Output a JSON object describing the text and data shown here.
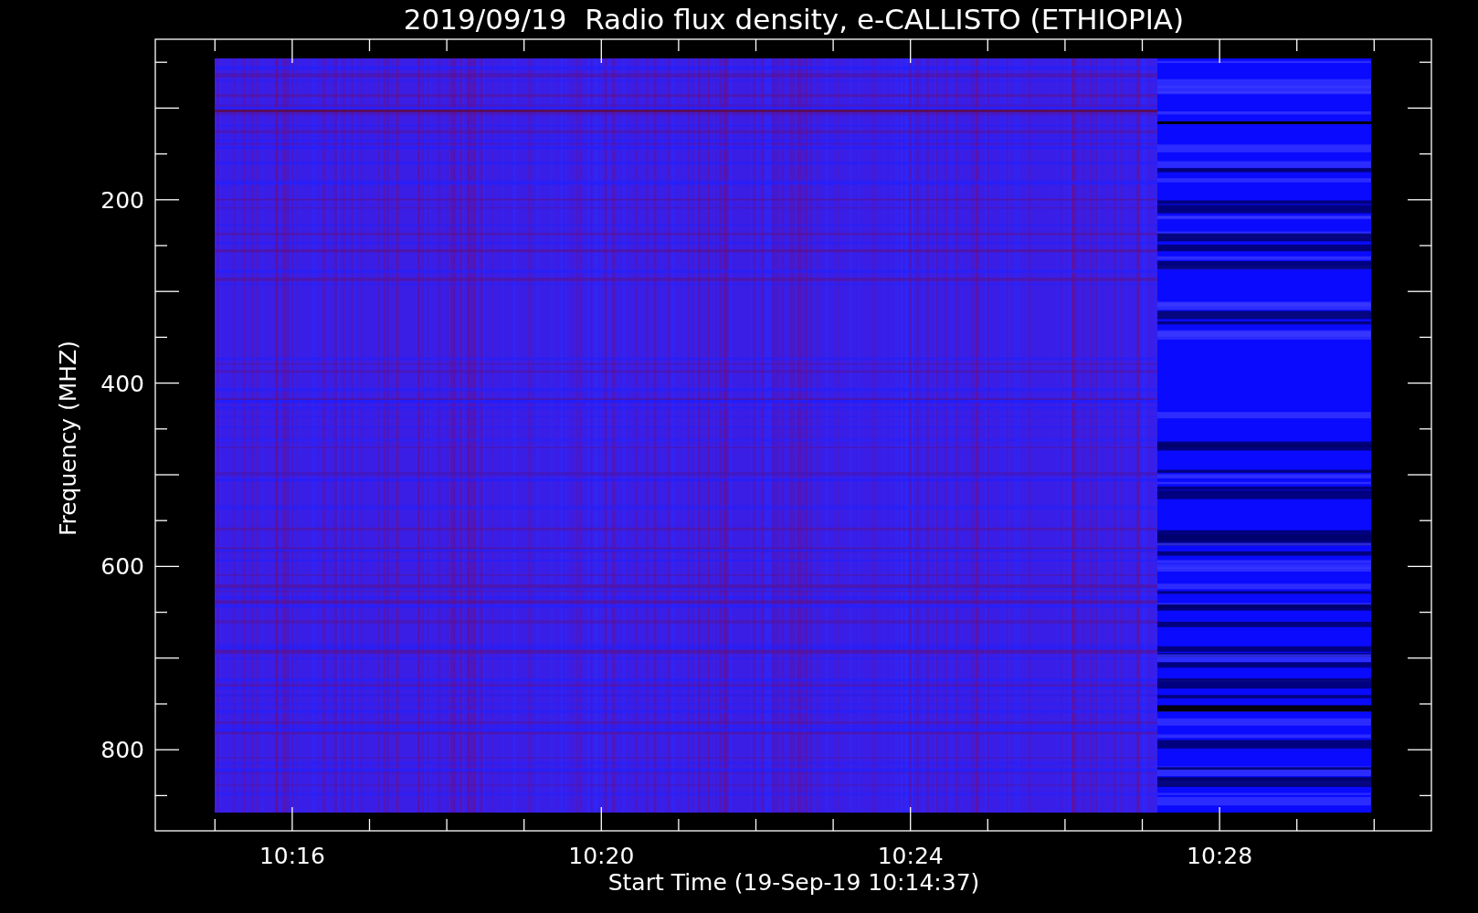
{
  "title": "2019/09/19  Radio flux density, e-CALLISTO (ETHIOPIA)",
  "y_axis": {
    "label": "Frequency (MHZ)",
    "ticks": [
      "200",
      "400",
      "600",
      "800"
    ]
  },
  "x_axis": {
    "label": "Start Time (19-Sep-19 10:14:37)",
    "ticks": [
      "10:16",
      "10:20",
      "10:24",
      "10:28"
    ]
  }
}
